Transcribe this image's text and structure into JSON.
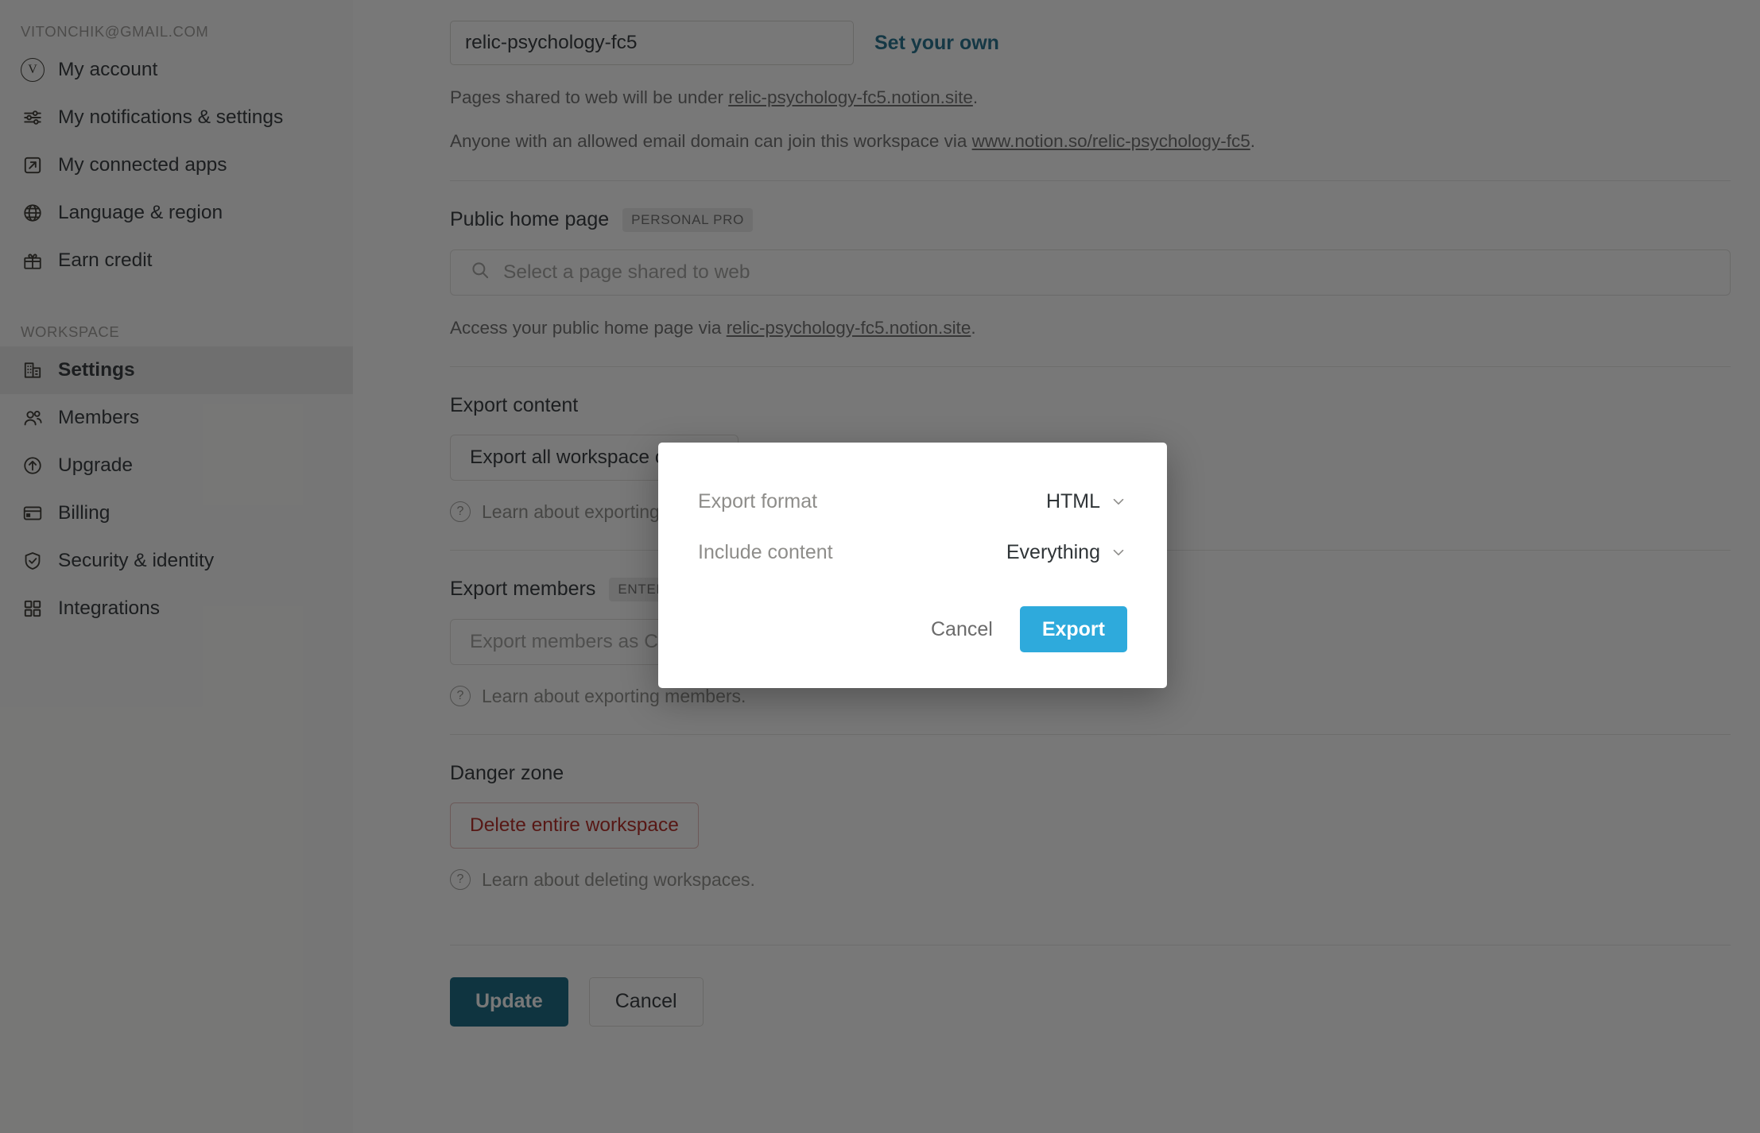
{
  "sidebar": {
    "account_email": "VITONCHIK@GMAIL.COM",
    "account_avatar_letter": "V",
    "personal_items": [
      {
        "label": "My account",
        "icon": "avatar-icon"
      },
      {
        "label": "My notifications & settings",
        "icon": "sliders-icon"
      },
      {
        "label": "My connected apps",
        "icon": "external-link-icon"
      },
      {
        "label": "Language & region",
        "icon": "globe-icon"
      },
      {
        "label": "Earn credit",
        "icon": "gift-icon"
      }
    ],
    "workspace_label": "WORKSPACE",
    "workspace_items": [
      {
        "label": "Settings",
        "icon": "building-icon",
        "active": true
      },
      {
        "label": "Members",
        "icon": "people-icon",
        "active": false
      },
      {
        "label": "Upgrade",
        "icon": "arrow-up-circle-icon",
        "active": false
      },
      {
        "label": "Billing",
        "icon": "credit-card-icon",
        "active": false
      },
      {
        "label": "Security & identity",
        "icon": "shield-check-icon",
        "active": false
      },
      {
        "label": "Integrations",
        "icon": "grid-icon",
        "active": false
      }
    ]
  },
  "main": {
    "domain": {
      "value": "relic-psychology-fc5",
      "placeholder": "relic-psychology-fc5",
      "set_your_own_label": "Set your own",
      "help_1_prefix": "Pages shared to web will be under ",
      "help_1_link": "relic-psychology-fc5.notion.site",
      "help_1_suffix": ".",
      "help_2_prefix": "Anyone with an allowed email domain can join this workspace via ",
      "help_2_link": "www.notion.so/relic-psychology-fc5",
      "help_2_suffix": "."
    },
    "public_home_page": {
      "title": "Public home page",
      "badge": "PERSONAL PRO",
      "search_placeholder": "Select a page shared to web",
      "help_prefix": "Access your public home page via ",
      "help_link": "relic-psychology-fc5.notion.site",
      "help_suffix": "."
    },
    "export_content": {
      "title": "Export content",
      "button_label": "Export all workspace content",
      "learn_label": "Learn about exporting workspaces."
    },
    "export_members": {
      "title": "Export members",
      "badge": "ENTERPRISE",
      "button_label": "Export members as CSV",
      "learn_label": "Learn about exporting members."
    },
    "danger_zone": {
      "title": "Danger zone",
      "delete_label": "Delete entire workspace",
      "learn_label": "Learn about deleting workspaces."
    },
    "footer": {
      "update_label": "Update",
      "cancel_label": "Cancel"
    }
  },
  "modal": {
    "format_label": "Export format",
    "format_value": "HTML",
    "include_label": "Include content",
    "include_value": "Everything",
    "cancel_label": "Cancel",
    "export_label": "Export"
  },
  "colors": {
    "link": "#1e6e8c",
    "export_button": "#2eaadc",
    "update_button": "#12657f",
    "danger": "#b3261e",
    "sidebar_active": "#ebebea"
  }
}
